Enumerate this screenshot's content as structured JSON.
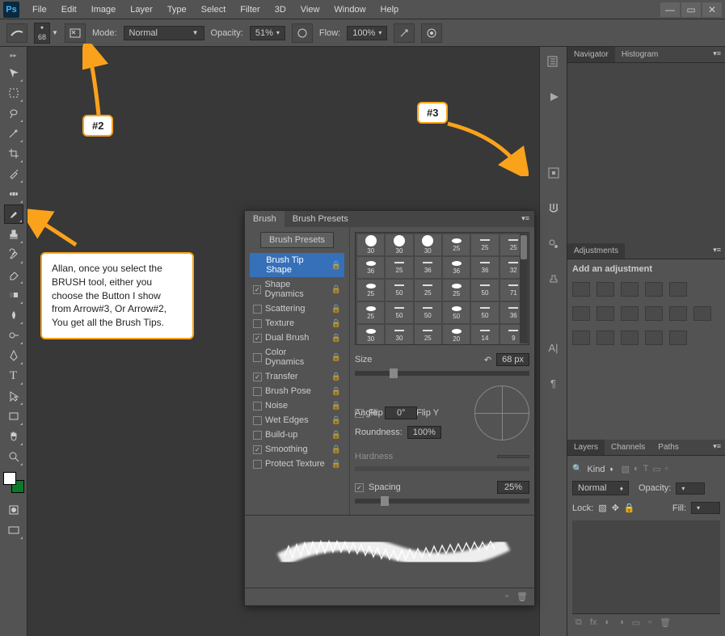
{
  "app": {
    "logo": "Ps"
  },
  "menu": [
    "File",
    "Edit",
    "Image",
    "Layer",
    "Type",
    "Select",
    "Filter",
    "3D",
    "View",
    "Window",
    "Help"
  ],
  "optbar": {
    "brush_size": "68",
    "mode_label": "Mode:",
    "mode_value": "Normal",
    "opacity_label": "Opacity:",
    "opacity_value": "51%",
    "flow_label": "Flow:",
    "flow_value": "100%"
  },
  "annotations": {
    "tag2": "#2",
    "tag3": "#3",
    "callout": "Allan, once you select the BRUSH tool, either you choose the Button I show from Arrow#3, Or Arrow#2, You get all the Brush Tips."
  },
  "brushpanel": {
    "tab_brush": "Brush",
    "tab_presets": "Brush Presets",
    "btn_presets": "Brush Presets",
    "items": [
      {
        "label": "Brush Tip Shape",
        "checked": null,
        "selected": true
      },
      {
        "label": "Shape Dynamics",
        "checked": true
      },
      {
        "label": "Scattering",
        "checked": false
      },
      {
        "label": "Texture",
        "checked": false
      },
      {
        "label": "Dual Brush",
        "checked": true
      },
      {
        "label": "Color Dynamics",
        "checked": false
      },
      {
        "label": "Transfer",
        "checked": true
      },
      {
        "label": "Brush Pose",
        "checked": false
      },
      {
        "label": "Noise",
        "checked": false
      },
      {
        "label": "Wet Edges",
        "checked": false
      },
      {
        "label": "Build-up",
        "checked": false
      },
      {
        "label": "Smoothing",
        "checked": true
      },
      {
        "label": "Protect Texture",
        "checked": false
      }
    ],
    "grid_sizes": [
      "30",
      "30",
      "30",
      "25",
      "25",
      "25",
      "36",
      "25",
      "36",
      "36",
      "36",
      "32",
      "25",
      "50",
      "25",
      "25",
      "50",
      "71",
      "25",
      "50",
      "50",
      "50",
      "50",
      "36",
      "30",
      "30",
      "25",
      "20",
      "14",
      "9"
    ],
    "size_label": "Size",
    "size_value": "68 px",
    "flipx": "Flip X",
    "flipy": "Flip Y",
    "angle_label": "Angle:",
    "angle_value": "0°",
    "round_label": "Roundness:",
    "round_value": "100%",
    "hardness_label": "Hardness",
    "spacing_label": "Spacing",
    "spacing_value": "25%"
  },
  "right": {
    "nav_tab": "Navigator",
    "hist_tab": "Histogram",
    "adj_tab": "Adjustments",
    "adj_text": "Add an adjustment",
    "layers_tab": "Layers",
    "channels_tab": "Channels",
    "paths_tab": "Paths",
    "kind": "Kind",
    "blend": "Normal",
    "opacity_label": "Opacity:",
    "lock": "Lock:",
    "fill": "Fill:"
  }
}
